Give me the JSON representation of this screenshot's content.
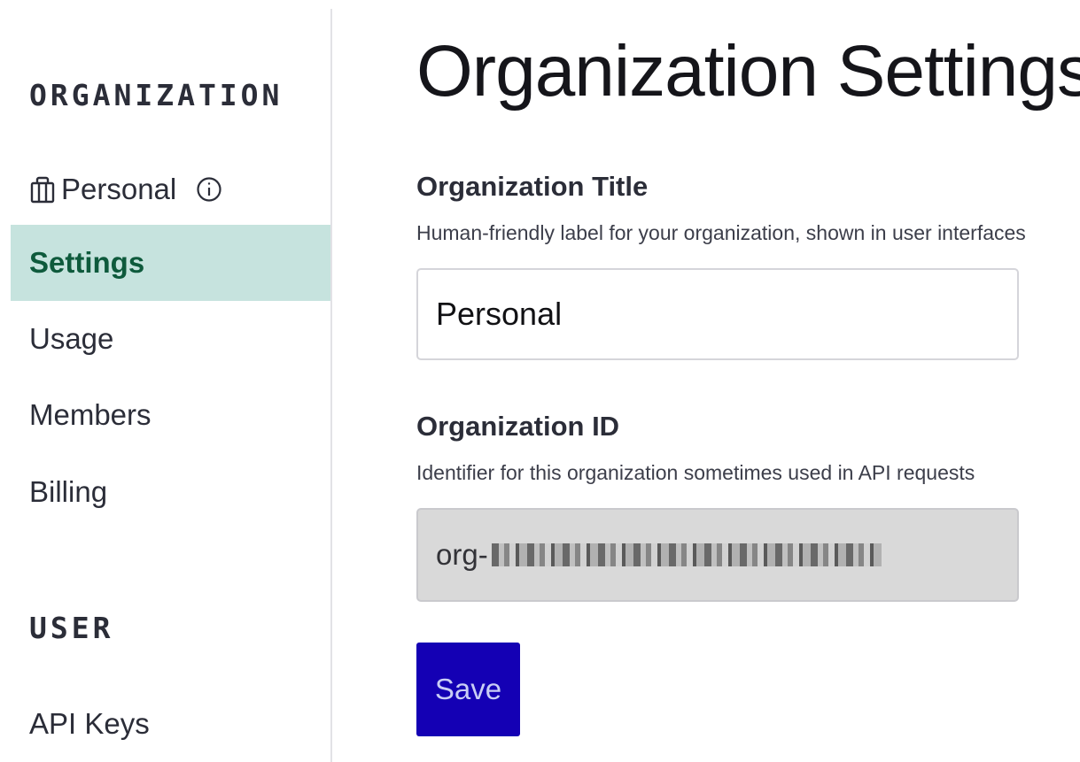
{
  "sidebar": {
    "org_section_heading": "ORGANIZATION",
    "org_switcher": {
      "label": "Personal",
      "icon": "building-icon",
      "info_icon": "info-icon"
    },
    "org_items": [
      {
        "label": "Settings",
        "active": true
      },
      {
        "label": "Usage",
        "active": false
      },
      {
        "label": "Members",
        "active": false
      },
      {
        "label": "Billing",
        "active": false
      }
    ],
    "user_section_heading": "USER",
    "user_items": [
      {
        "label": "API Keys",
        "active": false
      }
    ]
  },
  "main": {
    "title": "Organization Settings",
    "org_title_field": {
      "label": "Organization Title",
      "help": "Human-friendly label for your organization, shown in user interfaces",
      "value": "Personal"
    },
    "org_id_field": {
      "label": "Organization ID",
      "help": "Identifier for this organization sometimes used in API requests",
      "value_prefix": "org-"
    },
    "save_label": "Save"
  },
  "colors": {
    "active_bg": "#c6e3de",
    "active_text": "#0e5a3c",
    "primary_button": "#1400b4",
    "readonly_bg": "#d9d9d9"
  }
}
